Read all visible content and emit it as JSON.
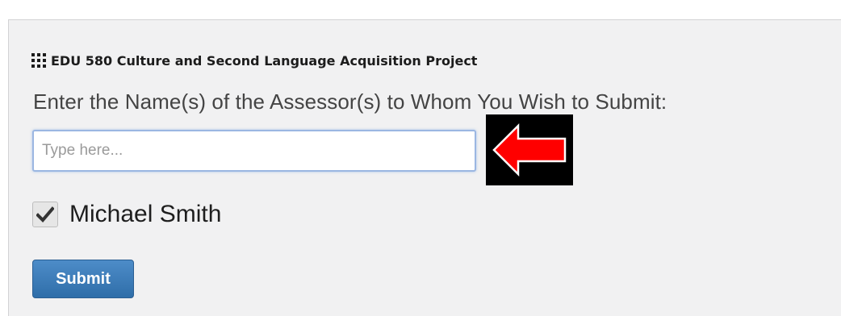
{
  "project": {
    "icon": "grid-icon",
    "title": "EDU 580 Culture and Second Language Acquisition Project"
  },
  "prompt": "Enter the Name(s) of the Assessor(s) to Whom You Wish to Submit:",
  "search": {
    "value": "",
    "placeholder": "Type here..."
  },
  "annotation": {
    "icon": "red-arrow-left-icon",
    "color": "#ff0000",
    "background": "#000000"
  },
  "assessors": [
    {
      "name": "Michael Smith",
      "checked": true
    }
  ],
  "submit_label": "Submit",
  "colors": {
    "panel_background": "#f1f1f2",
    "button_primary": "#3a7bbf",
    "input_focus_border": "#9bb7e2"
  }
}
